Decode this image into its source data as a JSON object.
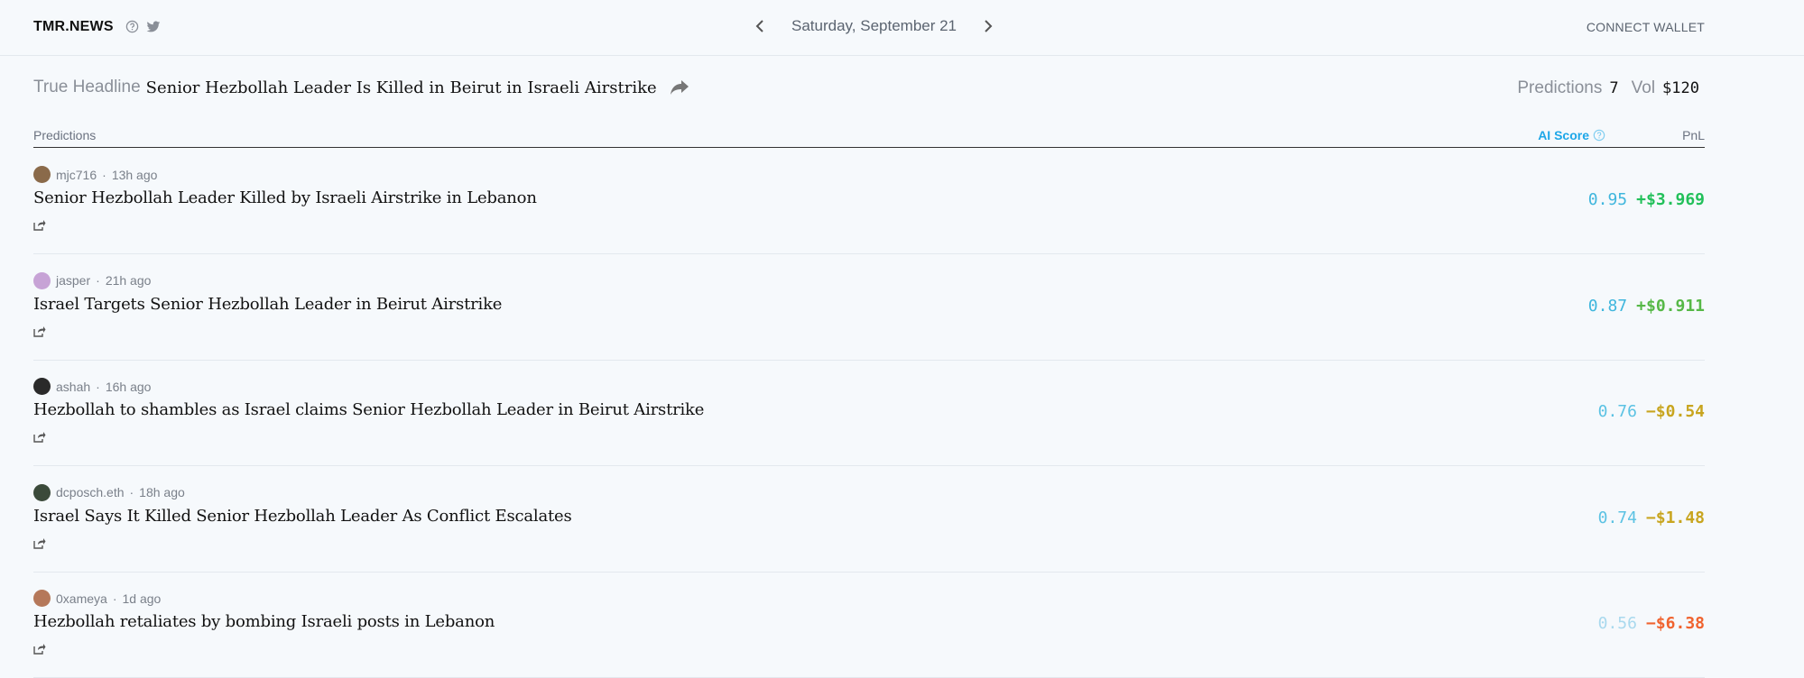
{
  "header": {
    "brand": "TMR.NEWS",
    "date": "Saturday, September 21",
    "connect_wallet": "CONNECT WALLET"
  },
  "icons": {
    "help": "help-circle-icon",
    "social": "twitter-icon",
    "prev": "chevron-left-icon",
    "next": "chevron-right-icon",
    "share": "share-icon"
  },
  "headline": {
    "label": "True Headline",
    "text": "Senior Hezbollah Leader Is Killed in Beirut in Israeli Airstrike",
    "predictions_label": "Predictions",
    "predictions_count": "7",
    "vol_label": "Vol",
    "vol_value": "$120"
  },
  "columns": {
    "predictions": "Predictions",
    "ai_score": "AI Score",
    "pnl": "PnL"
  },
  "colors": {
    "ai_score": "#1ea7e8",
    "positive_strong": "#22c05a",
    "positive_weak": "#56b847",
    "negative_weak": "#c8a51f",
    "negative_strong": "#f0632f"
  },
  "predictions": [
    {
      "user": "mjc716",
      "time": "13h ago",
      "title": "Senior Hezbollah Leader Killed by Israeli Airstrike in Lebanon",
      "ai_score": "0.95",
      "pnl": "+$3.969",
      "pnl_color": "#22c05a",
      "ai_color": "#3fb6dd",
      "avatar_color": "#8a6a4a"
    },
    {
      "user": "jasper",
      "time": "21h ago",
      "title": "Israel Targets Senior Hezbollah Leader in Beirut Airstrike",
      "ai_score": "0.87",
      "pnl": "+$0.911",
      "pnl_color": "#56b847",
      "ai_color": "#3fb6dd",
      "avatar_color": "#c7a3d6"
    },
    {
      "user": "ashah",
      "time": "16h ago",
      "title": "Hezbollah to shambles as Israel claims Senior Hezbollah Leader in Beirut Airstrike",
      "ai_score": "0.76",
      "pnl": "−$0.54",
      "pnl_color": "#c8a51f",
      "ai_color": "#5bc2e3",
      "avatar_color": "#2a2a2a"
    },
    {
      "user": "dcposch.eth",
      "time": "18h ago",
      "title": "Israel Says It Killed Senior Hezbollah Leader As Conflict Escalates",
      "ai_score": "0.74",
      "pnl": "−$1.48",
      "pnl_color": "#c8a51f",
      "ai_color": "#5bc2e3",
      "avatar_color": "#3b4a3a"
    },
    {
      "user": "0xameya",
      "time": "1d ago",
      "title": "Hezbollah retaliates by bombing Israeli posts in Lebanon",
      "ai_score": "0.56",
      "pnl": "−$6.38",
      "pnl_color": "#f0632f",
      "ai_color": "#a9d9ee",
      "avatar_color": "#b5785a"
    }
  ]
}
